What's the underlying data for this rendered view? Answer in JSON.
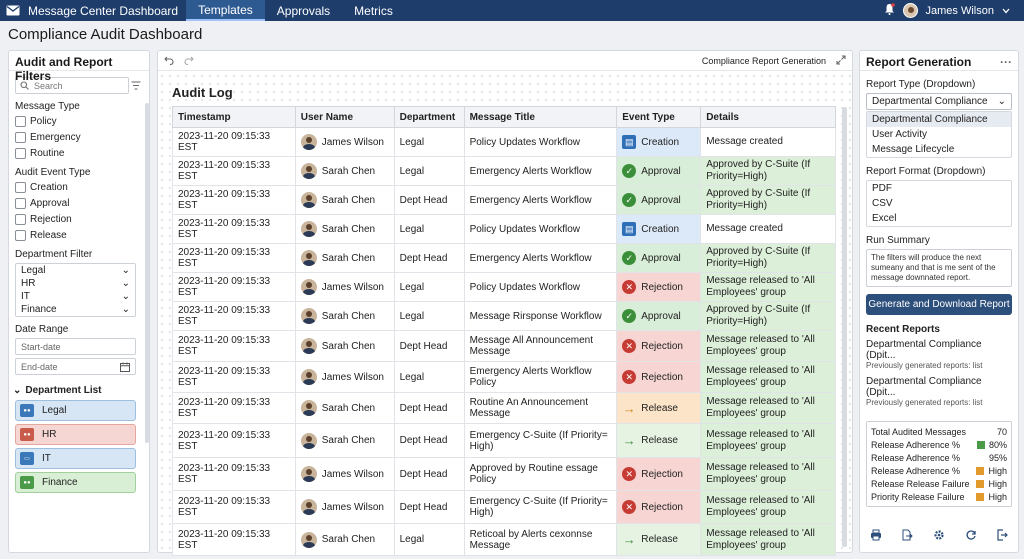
{
  "topbar": {
    "app_title": "Message Center Dashboard",
    "tabs": [
      "Templates",
      "Approvals",
      "Metrics"
    ],
    "user_name": "James Wilson"
  },
  "page_title": "Compliance Audit Dashboard",
  "filters": {
    "title": "Audit and Report Filters",
    "search_placeholder": "Search",
    "message_type_label": "Message Type",
    "message_types": [
      "Policy",
      "Emergency",
      "Routine"
    ],
    "event_type_label": "Audit Event Type",
    "event_types": [
      "Creation",
      "Approval",
      "Rejection",
      "Release"
    ],
    "department_label": "Department Filter",
    "departments": [
      "Legal",
      "HR",
      "IT",
      "Finance"
    ],
    "date_range_label": "Date Range",
    "start_placeholder": "Start-date",
    "end_placeholder": "End-date",
    "dept_list_title": "Department List",
    "dept_list": [
      {
        "name": "Legal",
        "color": "#3a78b9",
        "bg": "#d6e6f5",
        "border": "#9cbfe0"
      },
      {
        "name": "HR",
        "color": "#c85b4a",
        "bg": "#f6d6d2",
        "border": "#e3a79e"
      },
      {
        "name": "IT",
        "color": "#3a78b9",
        "bg": "#d6e6f5",
        "border": "#9cbfe0"
      },
      {
        "name": "Finance",
        "color": "#4b9a48",
        "bg": "#d8efd5",
        "border": "#a3cf9e"
      }
    ]
  },
  "center": {
    "toolbar_label": "Compliance Report Generation",
    "audit_title": "Audit Log",
    "columns": [
      "Timestamp",
      "User Name",
      "Department",
      "Message Title",
      "Event Type",
      "Details"
    ],
    "rows": [
      {
        "ts": "2023-11-20 09:15:33 EST",
        "user": "James Wilson",
        "dept": "Legal",
        "title": "Policy Updates Workflow",
        "event": "Creation",
        "details": "Message created"
      },
      {
        "ts": "2023-11-20 09:15:33 EST",
        "user": "Sarah Chen",
        "dept": "Legal",
        "title": "Emergency Alerts Workflow",
        "event": "Approval",
        "details": "Approved by C-Suite (If Priority=High)"
      },
      {
        "ts": "2023-11-20 09:15:33 EST",
        "user": "Sarah Chen",
        "dept": "Dept Head",
        "title": "Emergency Alerts Workflow",
        "event": "Approval",
        "details": "Approved by C-Suite (If Priority=High)"
      },
      {
        "ts": "2023-11-20 09:15:33 EST",
        "user": "Sarah Chen",
        "dept": "Legal",
        "title": "Policy Updates Workflow",
        "event": "Creation",
        "details": "Message created"
      },
      {
        "ts": "2023-11-20 09:15:33 EST",
        "user": "Sarah Chen",
        "dept": "Dept Head",
        "title": "Emergency Alerts Workflow",
        "event": "Approval",
        "details": "Approved by C-Suite (If Priority=High)"
      },
      {
        "ts": "2023-11-20 09:15:33 EST",
        "user": "James Wilson",
        "dept": "Legal",
        "title": "Policy Updates Workflow",
        "event": "Rejection",
        "details": "Message released to 'All Employees' group"
      },
      {
        "ts": "2023-11-20 09:15:33 EST",
        "user": "Sarah Chen",
        "dept": "Legal",
        "title": "Message Rirsponse Workflow",
        "event": "Approval",
        "details": "Approved by C-Suite (If Priority=High)"
      },
      {
        "ts": "2023-11-20 09:15:33 EST",
        "user": "Sarah Chen",
        "dept": "Dept Head",
        "title": "Message All Announcement Message",
        "event": "Rejection",
        "details": "Message released to 'All Employees' group"
      },
      {
        "ts": "2023-11-20 09:15:33 EST",
        "user": "James Wilson",
        "dept": "Legal",
        "title": "Emergency Alerts Workflow Policy",
        "event": "Rejection",
        "details": "Message released to 'All Employees' group"
      },
      {
        "ts": "2023-11-20 09:15:33 EST",
        "user": "Sarah Chen",
        "dept": "Dept Head",
        "title": "Routine An Announcement Message",
        "event": "Release",
        "details": "Message released to 'All Employees' group"
      },
      {
        "ts": "2023-11-20 09:15:33 EST",
        "user": "Sarah Chen",
        "dept": "Dept Head",
        "title": "Emergency C-Suite (If Priority= High)",
        "event": "Release",
        "details": "Message released to 'All Employees' group"
      },
      {
        "ts": "2023-11-20 09:15:33 EST",
        "user": "James Wilson",
        "dept": "Dept Head",
        "title": "Approved by Routine essage Policy",
        "event": "Rejection",
        "details": "Message released to 'All Employees' group"
      },
      {
        "ts": "2023-11-20 09:15:33 EST",
        "user": "James Wilson",
        "dept": "Dept Head",
        "title": "Emergency C-Suite (If Priority= High)",
        "event": "Rejection",
        "details": "Message released to 'All Employees' group"
      },
      {
        "ts": "2023-11-20 09:15:33 EST",
        "user": "Sarah Chen",
        "dept": "Legal",
        "title": "Reticoal by Alerts cexonnse Message",
        "event": "Release",
        "details": "Message released to 'All Employees' group"
      }
    ]
  },
  "report": {
    "title": "Report Generation",
    "type_label": "Report Type (Dropdown)",
    "type_selected": "Departmental Compliance",
    "type_options": [
      "Departmental Compliance",
      "User Activity",
      "Message Lifecycle"
    ],
    "format_label": "Report Format (Dropdown)",
    "format_options": [
      "PDF",
      "CSV",
      "Excel"
    ],
    "summary_label": "Run Summary",
    "summary_text": "The filters will produce the next sumeany and that is me sent of the message downnated report.",
    "generate_button": "Generate and Download Report",
    "recent_title": "Recent Reports",
    "recent": [
      {
        "name": "Departmental Compliance (Dpit...",
        "sub": "Previously generated reports: list"
      },
      {
        "name": "Departmental Compliance (Dpit...",
        "sub": "Previously generated reports: list"
      }
    ],
    "stats": [
      {
        "label": "Total Audited Messages",
        "value": "70",
        "color": ""
      },
      {
        "label": "Release Adherence %",
        "value": "80%",
        "color": "#4b9a48"
      },
      {
        "label": "Release Adherence %",
        "value": "95%",
        "color": ""
      },
      {
        "label": "Release Adherence %",
        "value": "High",
        "color": "#e39a2d"
      },
      {
        "label": "Release Release Failure",
        "value": "High",
        "color": "#e39a2d"
      },
      {
        "label": "Priority Release Failure",
        "value": "High",
        "color": "#e39a2d"
      }
    ]
  }
}
